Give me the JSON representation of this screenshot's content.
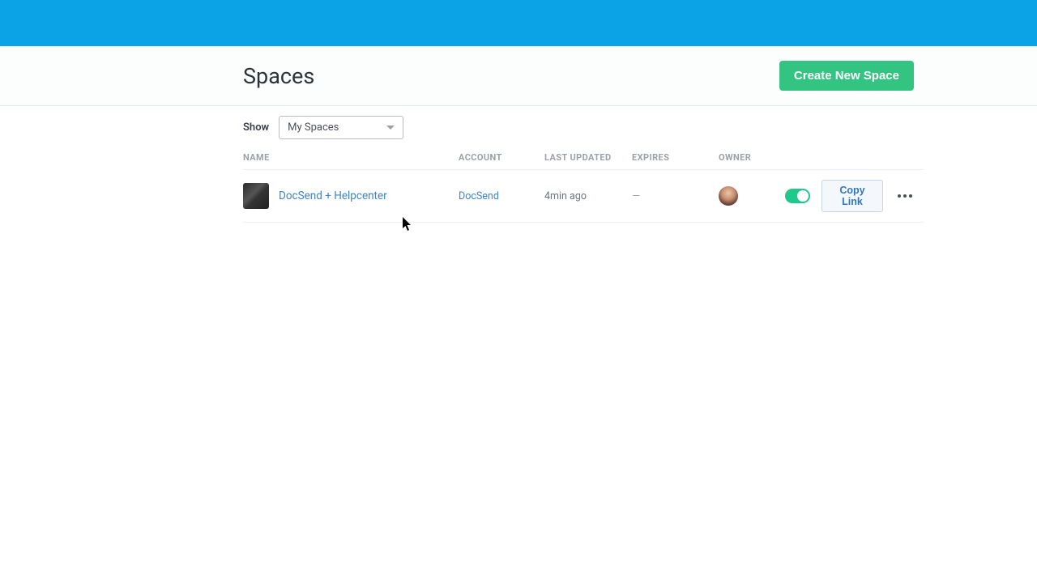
{
  "header": {
    "title": "Spaces",
    "create_button": "Create New Space"
  },
  "filter": {
    "show_label": "Show",
    "selected": "My Spaces"
  },
  "columns": {
    "name": "NAME",
    "account": "ACCOUNT",
    "last_updated": "LAST UPDATED",
    "expires": "EXPIRES",
    "owner": "OWNER"
  },
  "rows": [
    {
      "name": "DocSend + Helpcenter",
      "account": "DocSend",
      "last_updated": "4min ago",
      "expires": "—",
      "copy_label": "Copy Link"
    }
  ]
}
